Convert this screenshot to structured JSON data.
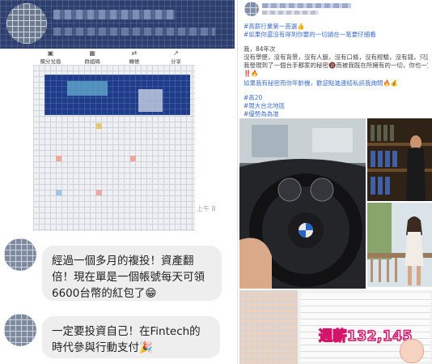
{
  "left_panel": {
    "profile_header": {
      "name": "",
      "avatar": "avatar"
    },
    "action_bar": [
      {
        "label": "積分兌換",
        "icon": "gift-icon"
      },
      {
        "label": "群組碼",
        "icon": "qr-code-icon"
      },
      {
        "label": "轉帳",
        "icon": "transfer-icon"
      },
      {
        "label": "分享",
        "icon": "share-icon"
      }
    ],
    "timestamp": "上午 8",
    "messages": [
      {
        "text": "經過一個多月的複投！資產翻倍！現在單是一個帳號每天可領6600台幣的紅包了",
        "emoji": "😁"
      },
      {
        "text": "一定要投資自己！在Fintech的時代參與行動支付",
        "emoji": "🎉"
      }
    ]
  },
  "right_panel": {
    "post": {
      "author": "",
      "meta": "",
      "lines": [
        {
          "text": "#高薪行業第一首選👍",
          "kind": "tag"
        },
        {
          "text": "#如果你還沒有得到你要的一切請在一笔要仔細看",
          "kind": "tag"
        },
        {
          "text": "",
          "kind": "plain"
        },
        {
          "text": "我，84年次",
          "kind": "plain"
        },
        {
          "text": "沒有學歷，沒有背景，沒有人脈，沒有口條，沒有經驗，沒有錢，只因為讓",
          "kind": "plain"
        },
        {
          "text": "我發現到了一個台手都家的秘密🔞而被我既在所擁有的一切，你也一定可以",
          "kind": "plain"
        },
        {
          "text": "‼️🔥",
          "kind": "plain"
        },
        {
          "text": "如果我有秘密而你年齡機，歡迎點進連結私訊我詢問🔥💰",
          "kind": "plain"
        },
        {
          "text": "",
          "kind": "plain"
        },
        {
          "text": "#高20",
          "kind": "tag"
        },
        {
          "text": "#現大台北地區",
          "kind": "tag"
        },
        {
          "text": "#優勢為為准",
          "kind": "tag"
        }
      ]
    },
    "photo_overlay_text": "週薪132,145",
    "photos": [
      {
        "name": "car-steering-wheel-photo"
      },
      {
        "name": "wine-shelf-photo"
      },
      {
        "name": "woman-balcony-photo"
      },
      {
        "name": "earnings-screenshot-photo"
      }
    ]
  }
}
